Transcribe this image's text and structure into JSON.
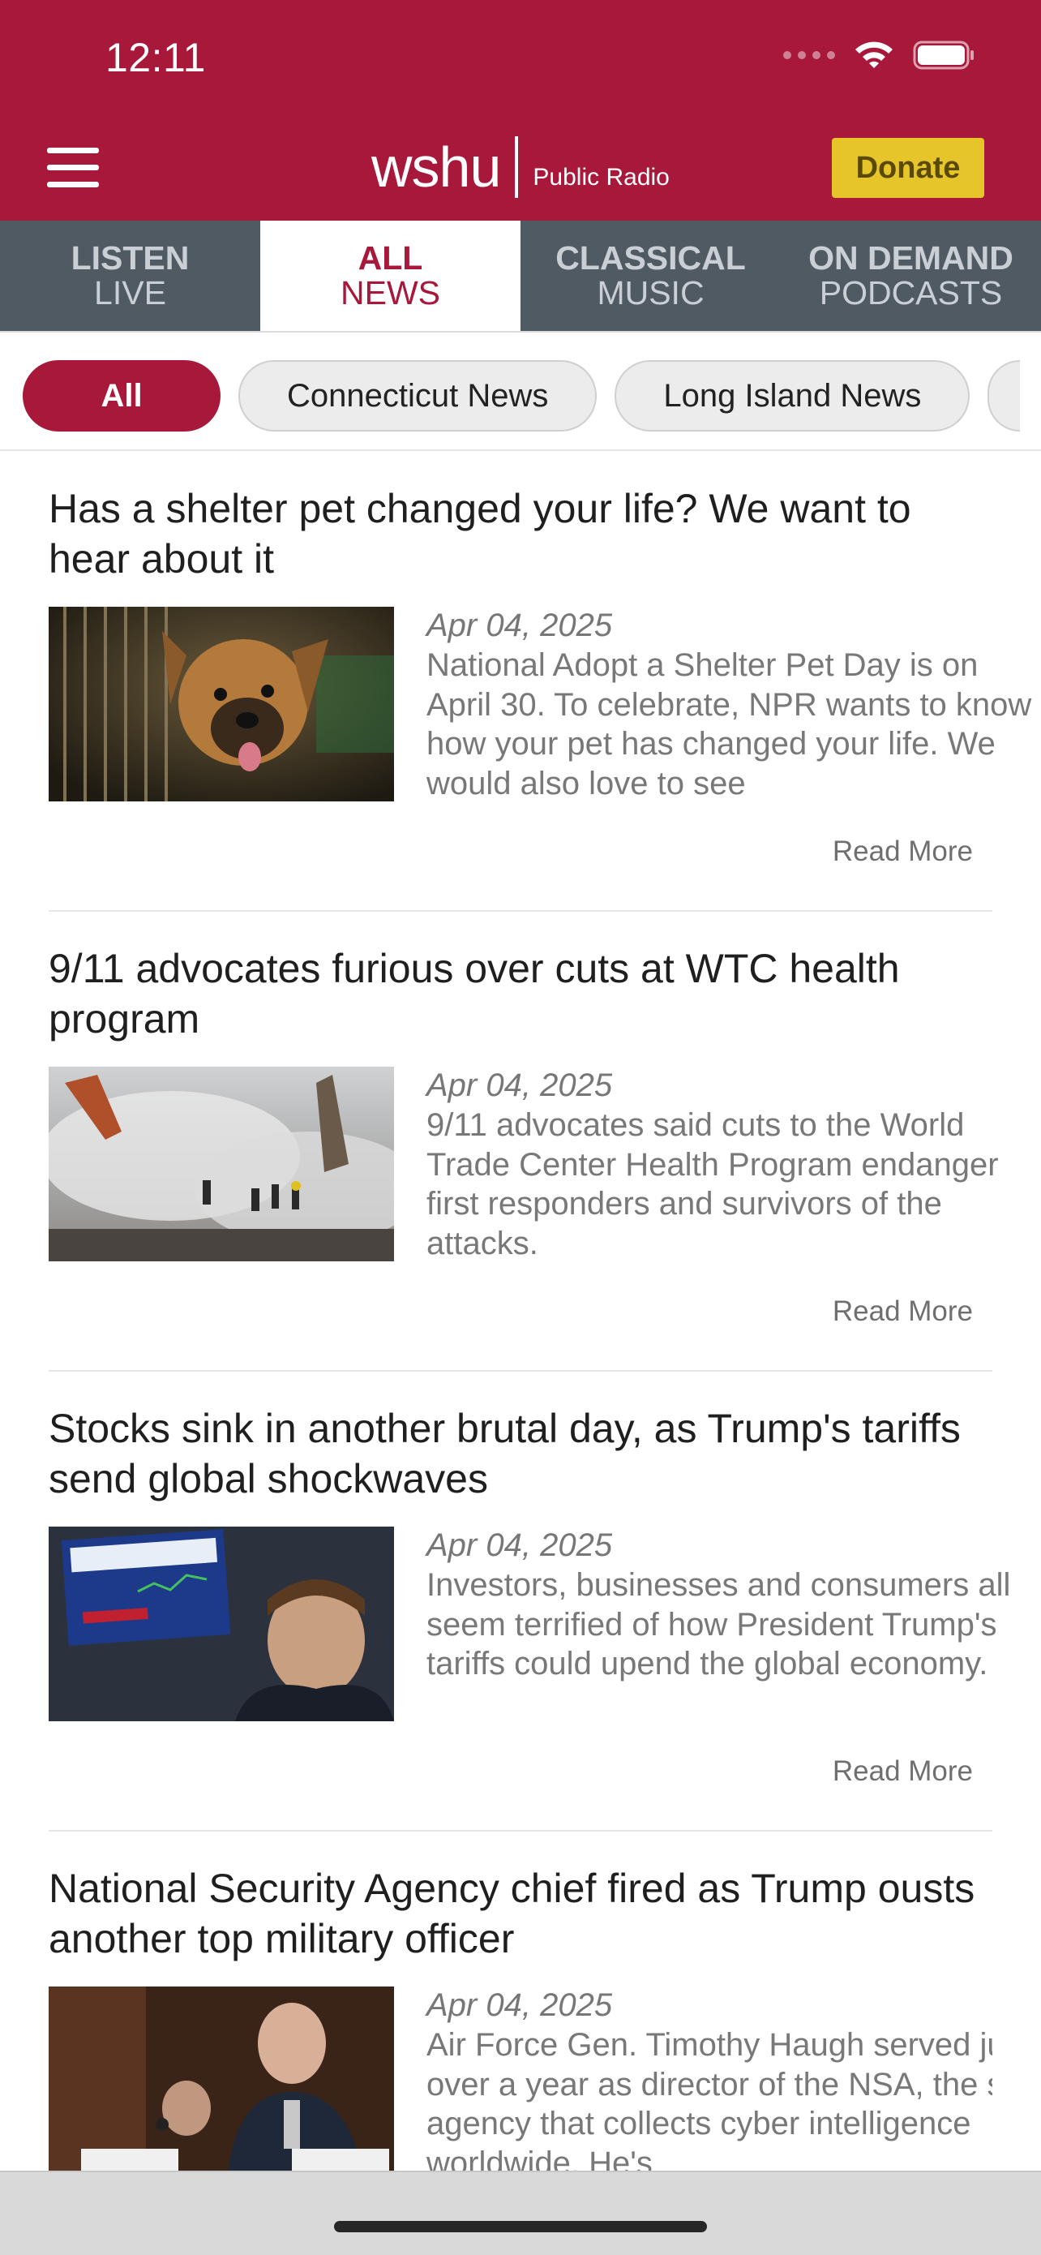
{
  "status_bar": {
    "time": "12:11"
  },
  "header": {
    "logo_word": "wshu",
    "logo_sub": "Public Radio",
    "donate_label": "Donate",
    "brand_color": "#a8183a",
    "donate_color": "#e6c52a"
  },
  "tabs": [
    {
      "line1": "LISTEN",
      "line2": "LIVE",
      "active": false
    },
    {
      "line1": "ALL",
      "line2": "NEWS",
      "active": true
    },
    {
      "line1": "CLASSICAL",
      "line2": "MUSIC",
      "active": false
    },
    {
      "line1": "ON DEMAND",
      "line2": "PODCASTS",
      "active": false
    }
  ],
  "filters": [
    {
      "label": "All",
      "active": true
    },
    {
      "label": "Connecticut News",
      "active": false
    },
    {
      "label": "Long Island News",
      "active": false
    }
  ],
  "articles": [
    {
      "title": "Has a shelter pet changed your life? We want to hear about it",
      "date": "Apr 04, 2025",
      "summary": "National Adopt a Shelter Pet Day is on April 30. To celebrate, NPR wants to know how your pet has changed your life. We would also love to see",
      "read_more": "Read More",
      "image": "shelter-puppy-photo"
    },
    {
      "title": "9/11 advocates furious over cuts at WTC health program",
      "date": "Apr 04, 2025",
      "summary": "9/11 advocates said cuts to the World Trade Center Health Program endanger first responders and survivors of the attacks.",
      "read_more": "Read More",
      "image": "ground-zero-smoke-photo"
    },
    {
      "title": "Stocks sink in another brutal day, as Trump's tariffs send global shockwaves",
      "date": "Apr 04, 2025",
      "summary": "Investors, businesses and consumers all seem terrified of how President Trump's tariffs could upend the global economy.",
      "read_more": "Read More",
      "image": "stock-trader-photo"
    },
    {
      "title": "National Security Agency chief fired as Trump ousts another top military officer",
      "date": "Apr 04, 2025",
      "summary": "Air Force Gen. Timothy Haugh served just over a year as director of the NSA, the spy agency that collects cyber intelligence worldwide. He's",
      "read_more": "",
      "image": "general-testifying-photo"
    }
  ]
}
